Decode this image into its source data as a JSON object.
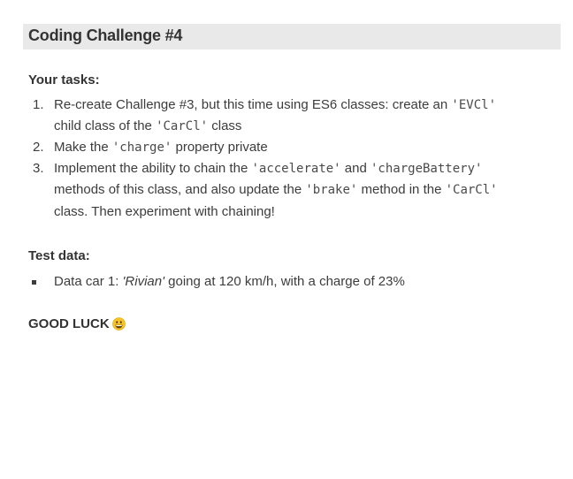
{
  "title": "Coding Challenge #4",
  "tasks_heading": "Your tasks:",
  "tasks": [
    {
      "number": "1.",
      "line1": {
        "t1": "Re-create Challenge #3, but this time using ES6 classes: create an ",
        "c1": "'EVCl'"
      },
      "line2": {
        "t1": "child class of the ",
        "c1": "'CarCl'",
        "t2": " class"
      }
    },
    {
      "number": "2.",
      "line1": {
        "t1": "Make the ",
        "c1": "'charge'",
        "t2": " property private"
      }
    },
    {
      "number": "3.",
      "line1": {
        "t1": "Implement the ability to chain the ",
        "c1": "'accelerate'",
        "t2": " and ",
        "c2": "'chargeBattery'"
      },
      "line2": {
        "t1": "methods of this class, and also update the ",
        "c1": "'brake'",
        "t2": " method in the ",
        "c2": "'CarCl'"
      },
      "line3": {
        "t1": "class. Then experiment with chaining!"
      }
    }
  ],
  "test_heading": "Test data:",
  "test_item": {
    "t1": "Data car 1: ",
    "name": "'Rivian'",
    "t2": " going at 120 km/h, with a charge of 23%"
  },
  "good_luck": "GOOD LUCK",
  "icons": {
    "emoji": "grinning-face-icon",
    "emoji_color": "#f7c325"
  }
}
